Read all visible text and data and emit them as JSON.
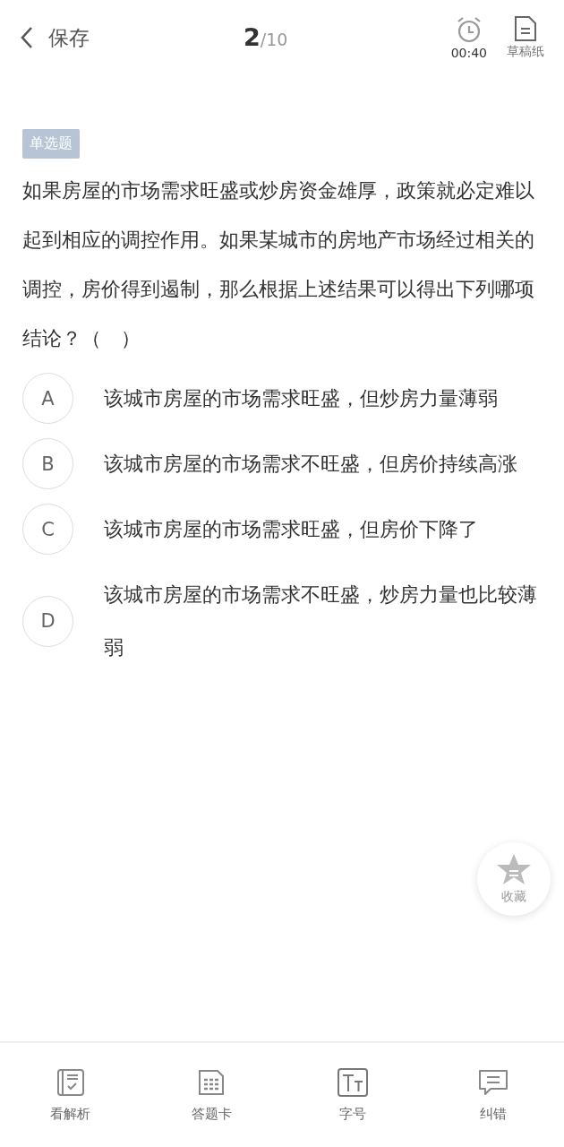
{
  "header": {
    "back_label": "保存",
    "current": "2",
    "total": "/10",
    "timer": "00:40",
    "scratch_label": "草稿纸"
  },
  "question": {
    "type_tag": "单选题",
    "text": "如果房屋的市场需求旺盛或炒房资金雄厚，政策就必定难以起到相应的调控作用。如果某城市的房地产市场经过相关的调控，房价得到遏制，那么根据上述结果可以得出下列哪项结论？（　）",
    "options": [
      {
        "letter": "A",
        "text": "该城市房屋的市场需求旺盛，但炒房力量薄弱",
        "selected": false
      },
      {
        "letter": "B",
        "text": "该城市房屋的市场需求不旺盛，但房价持续高涨",
        "selected": false
      },
      {
        "letter": "C",
        "text": "该城市房屋的市场需求旺盛，但房价下降了",
        "selected": false
      },
      {
        "letter": "D",
        "text": "该城市房屋的市场需求不旺盛，炒房力量也比较薄弱",
        "selected": false
      }
    ]
  },
  "favorite": {
    "label": "收藏"
  },
  "toolbar": [
    {
      "kind": "analysis",
      "label": "看解析"
    },
    {
      "kind": "answer_card",
      "label": "答题卡"
    },
    {
      "kind": "font_size",
      "label": "字号"
    },
    {
      "kind": "report",
      "label": "纠错"
    }
  ]
}
